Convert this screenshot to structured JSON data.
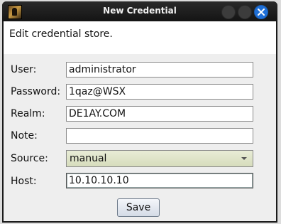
{
  "window": {
    "title": "New Credential"
  },
  "header": {
    "text": "Edit credential store."
  },
  "form": {
    "user_label": "User:",
    "user_value": "administrator",
    "password_label": "Password:",
    "password_value": "1qaz@WSX",
    "realm_label": "Realm:",
    "realm_value": "DE1AY.COM",
    "note_label": "Note:",
    "note_value": "",
    "source_label": "Source:",
    "source_value": "manual",
    "host_label": "Host:",
    "host_value": "10.10.10.10"
  },
  "actions": {
    "save_label": "Save"
  },
  "icons": {
    "app": "app-icon",
    "close": "close-icon",
    "dropdown": "chevron-down-icon"
  },
  "colors": {
    "titlebar": "#1a1a1a",
    "close_button": "#1f6fd6",
    "source_select": "#dfe4c8"
  }
}
